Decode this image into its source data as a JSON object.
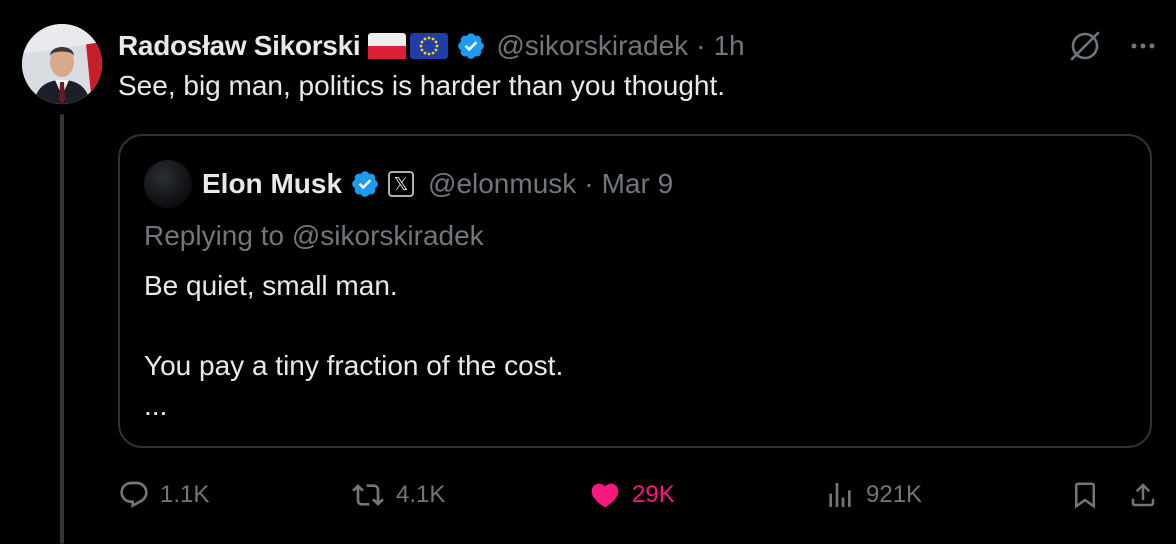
{
  "post": {
    "author_name": "Radosław Sikorski",
    "handle": "@sikorskiradek",
    "separator": "·",
    "time": "1h",
    "text": "See, big man, politics is harder than you thought.",
    "flags": [
      "poland-flag",
      "eu-flag"
    ],
    "verified": true
  },
  "quoted": {
    "author_name": "Elon Musk",
    "badge": "𝕏",
    "handle": "@elonmusk",
    "separator": "·",
    "date": "Mar 9",
    "replying_to": "Replying to @sikorskiradek",
    "line1": "Be quiet, small man.",
    "line2": "You pay a tiny fraction of the cost.",
    "more": "..."
  },
  "actions": {
    "replies": "1.1K",
    "reposts": "4.1K",
    "likes": "29K",
    "views": "921K"
  },
  "colors": {
    "background": "#000000",
    "text": "#e7e9ea",
    "muted": "#71767b",
    "verified": "#1d9bf0",
    "like": "#f91880",
    "border": "#2f3336"
  }
}
